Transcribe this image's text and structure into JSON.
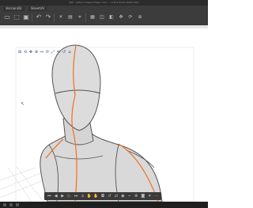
{
  "window": {
    "title": "PRE · (after) Dhagu(Dhagu.mdl) — CLIP STUDIO PAINT PRO"
  },
  "tabs": [
    "Version(B)",
    "Sheet(A)"
  ],
  "toolbar": {
    "icons": [
      "new-file",
      "open",
      "save",
      "undo",
      "redo",
      "clear",
      "fill",
      "transform",
      "grid",
      "ruler",
      "snap",
      "move",
      "rotate",
      "zoom"
    ]
  },
  "viewport_tools": {
    "icons": [
      "object-select",
      "camera-rotate",
      "pan",
      "zoom",
      "move",
      "rotate",
      "scale",
      "flip",
      "reset",
      "fit"
    ]
  },
  "bottom_toolbar": {
    "icons": [
      "first-frame",
      "prev",
      "play",
      "next",
      "last",
      "pose",
      "hand-left",
      "hand-right",
      "lock",
      "reset-pose",
      "mirror",
      "joint",
      "ik",
      "settings",
      "camera",
      "light",
      "more"
    ]
  },
  "colors": {
    "chrome_dark": "#3c3c3c",
    "figure_body": "#d9d9d9",
    "contour_line": "#f07020",
    "outline": "#555555"
  }
}
